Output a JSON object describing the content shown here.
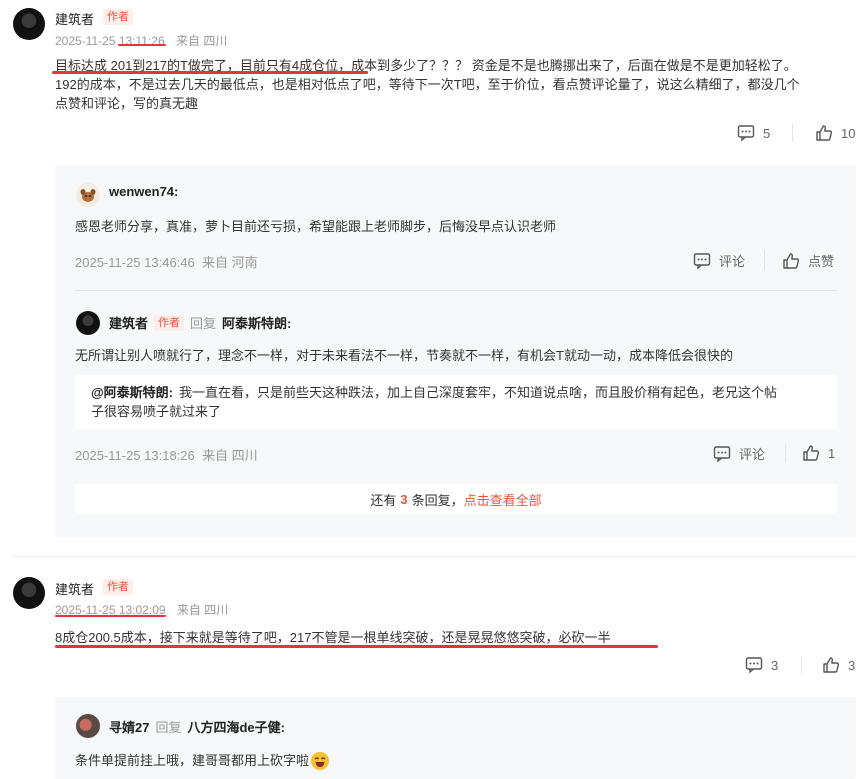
{
  "comment1": {
    "author": "建筑者",
    "badge": "作者",
    "date": "2025-11-25",
    "time": "13:11:26",
    "location": "来自 四川",
    "text_line1_highlight": "目标达成 201到217的T做完了，目前只有4成仓位",
    "text_line1_rest": "，成本到多少了？？？ 资金是不是也腾挪出来了，后面在做是不是更加轻松了。",
    "text_line2": "192的成本，不是过去几天的最低点，也是相对低点了吧，等待下一次T吧，至于价位，看点赞评论量了，说这么精细了，都没几个",
    "text_line3": "点赞和评论，写的真无趣",
    "comment_count": "5",
    "like_count": "10"
  },
  "reply1": {
    "author": "wenwen74:",
    "text": "感恩老师分享，真准，萝卜目前还亏损，希望能跟上老师脚步，后悔没早点认识老师",
    "meta": "2025-11-25 13:46:46  来自 河南",
    "comment_label": "评论",
    "like_label": "点赞"
  },
  "reply2": {
    "author": "建筑者",
    "badge": "作者",
    "reply_word": "回复",
    "target": "阿泰斯特朗:",
    "text": "无所谓让别人喷就行了，理念不一样，对于未来看法不一样，节奏就不一样，有机会T就动一动，成本降低会很快的",
    "quote_author": "@阿泰斯特朗:",
    "quote_line1": "我一直在看，只是前些天这种跌法，加上自己深度套牢，不知道说点啥，而且股价稍有起色，老兄这个帖",
    "quote_line2": "子很容易喷子就过来了",
    "meta": "2025-11-25 13:18:26  来自 四川",
    "comment_label": "评论",
    "like_count": "1"
  },
  "more_replies": {
    "prefix": "还有",
    "count": "3",
    "suffix": "条回复，",
    "link": "点击查看全部"
  },
  "comment2": {
    "author": "建筑者",
    "badge": "作者",
    "date": "2025-11-25 13:02:09",
    "location": "来自 四川",
    "text": "8成仓200.5成本，接下来就是等待了吧，217不管是一根单线突破，还是晃晃悠悠突破，必砍一半",
    "comment_count": "3",
    "like_count": "3"
  },
  "reply3": {
    "author": "寻婧27",
    "reply_word": "回复",
    "target": "八方四海de子健:",
    "text": "条件单提前挂上哦，建哥哥都用上砍字啦",
    "emoji": "😂"
  },
  "colors": {
    "accent": "#e8553b",
    "highlight_line": "#e8333a"
  }
}
